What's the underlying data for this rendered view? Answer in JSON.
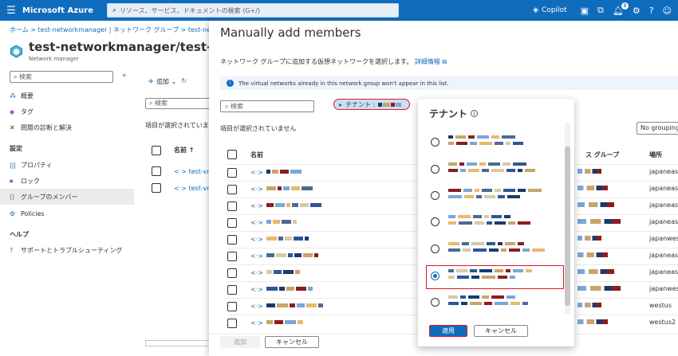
{
  "topbar": {
    "brand": "Microsoft Azure",
    "search_placeholder": "リソース、サービス、ドキュメントの検索 (G+/)",
    "copilot": "Copilot",
    "notifications_count": "3"
  },
  "background": {
    "breadcrumb": "ホーム  >  test-networkmanager | ネットワーク グループ  >  test-ne",
    "title": "test-networkmanager/test-gro",
    "subtitle": "Network manager",
    "side_search": "検索",
    "sidebar_items": [
      {
        "label": "概要",
        "icon": "overview-icon"
      },
      {
        "label": "タグ",
        "icon": "tag-icon"
      },
      {
        "label": "問題の診断と解決",
        "icon": "diagnose-icon"
      }
    ],
    "settings_head": "設定",
    "settings_items": [
      {
        "label": "プロパティ",
        "icon": "properties-icon"
      },
      {
        "label": "ロック",
        "icon": "lock-icon"
      },
      {
        "label": "グループのメンバー",
        "icon": "group-members-icon",
        "selected": true
      },
      {
        "label": "Policies",
        "icon": "policies-icon"
      }
    ],
    "help_head": "ヘルプ",
    "help_items": [
      {
        "label": "サポートとトラブルシューティング",
        "icon": "support-icon"
      }
    ],
    "toolbar_add": "追加",
    "filter_placeholder": "検索",
    "status": "項目が選択されていま",
    "col_name": "名前 ↑",
    "rows": [
      "test-vne",
      "test-vne"
    ]
  },
  "panel": {
    "title": "Manually add members",
    "description": "ネットワーク グループに追加する仮想ネットワークを選択します。",
    "learn_more": "詳細情報",
    "info": "The virtual networks already in this network group won't appear in this list.",
    "search_placeholder": "検索",
    "tenant_chip": "テナント :",
    "status": "項目が選択されていません",
    "grouping": "No grouping",
    "columns": {
      "name": "名前",
      "resource_group": "ス グループ",
      "location": "場所"
    },
    "locations": [
      "japaneast",
      "japaneast",
      "japaneast",
      "japaneast",
      "japanwest",
      "japaneast",
      "japaneast",
      "japanwest",
      "westus",
      "westus2"
    ],
    "add_button": "追加",
    "cancel_button": "キャンセル"
  },
  "popup": {
    "title": "テナント",
    "apply_button": "適用",
    "cancel_button": "キャンセル",
    "selected_index": 5
  }
}
